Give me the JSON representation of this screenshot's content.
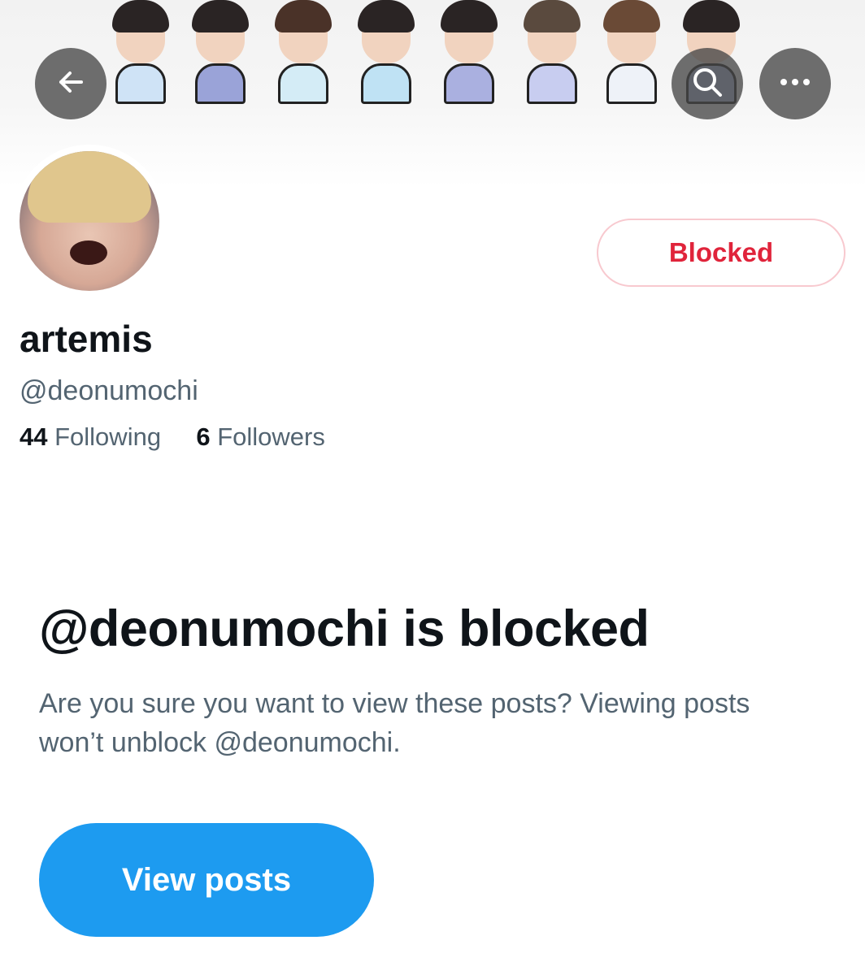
{
  "header": {
    "back_icon": "arrow-left-icon",
    "search_icon": "search-icon",
    "more_icon": "more-horizontal-icon",
    "banner_sticker_count": 8
  },
  "profile": {
    "display_name": "artemis",
    "handle": "@deonumochi",
    "following_count": "44",
    "following_label": "Following",
    "followers_count": "6",
    "followers_label": "Followers",
    "blocked_button_label": "Blocked"
  },
  "blocked_notice": {
    "title": "@deonumochi is blocked",
    "description": "Are you sure you want to view these posts? Viewing posts won’t unblock @deonumochi.",
    "view_button_label": "View posts"
  },
  "colors": {
    "accent_blue": "#1d9bf0",
    "blocked_red": "#e0243b",
    "blocked_border": "#f8c9cf",
    "secondary_text": "#536471",
    "primary_text": "#0f1419"
  }
}
